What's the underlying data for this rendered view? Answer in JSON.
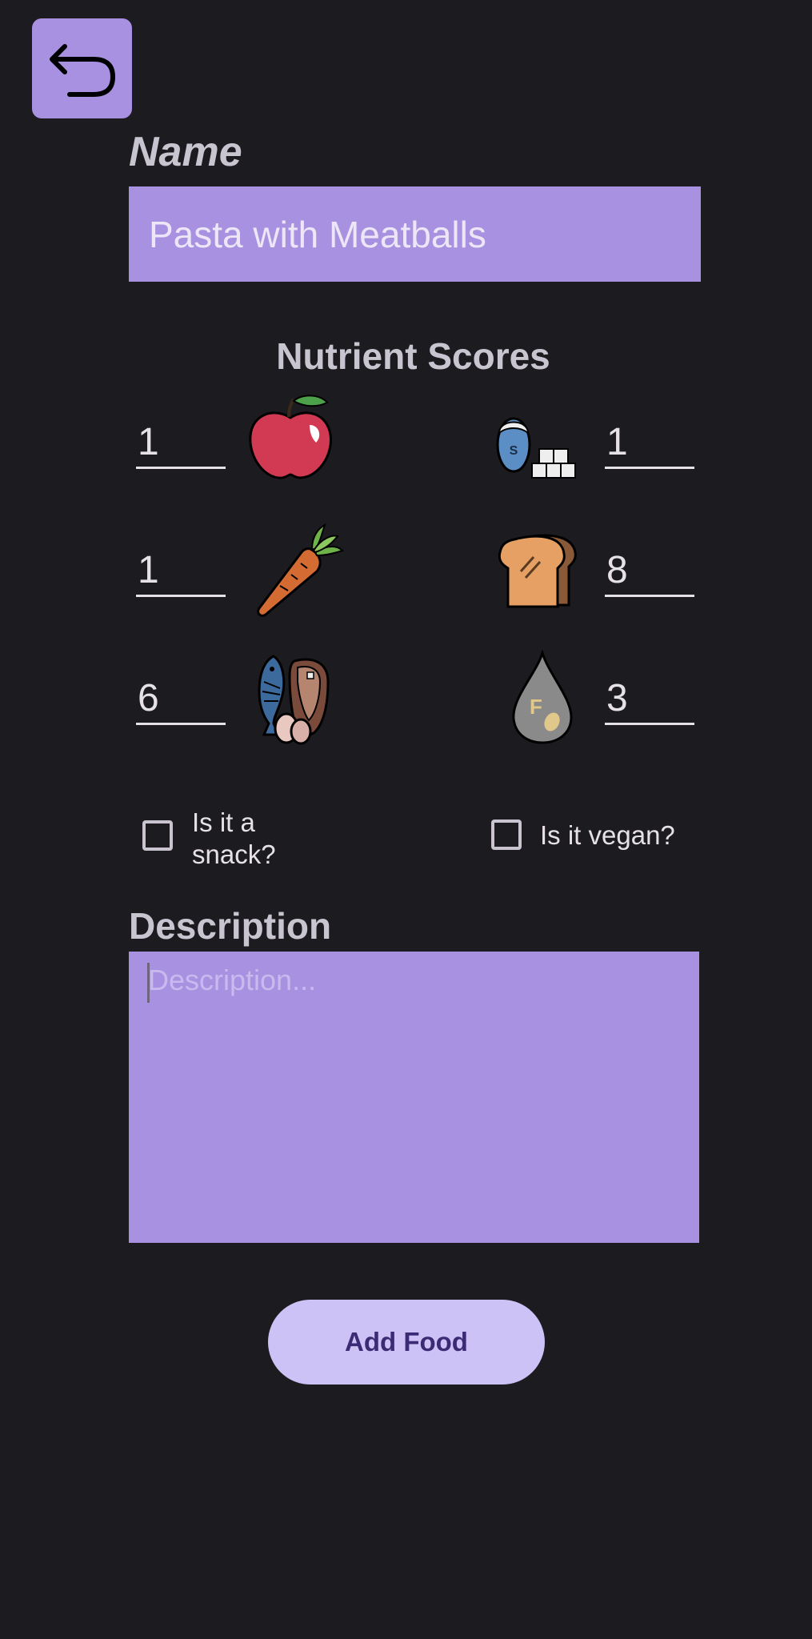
{
  "header": {
    "back_icon": "undo-arrow-icon"
  },
  "name": {
    "label": "Name",
    "value": "Pasta with Meatballs"
  },
  "nutrients": {
    "title": "Nutrient Scores",
    "items": [
      {
        "value": "1",
        "icon": "apple-icon"
      },
      {
        "value": "1",
        "icon": "salt-sugar-icon"
      },
      {
        "value": "1",
        "icon": "carrot-icon"
      },
      {
        "value": "8",
        "icon": "bread-icon"
      },
      {
        "value": "6",
        "icon": "protein-fish-meat-egg-icon"
      },
      {
        "value": "3",
        "icon": "fat-drop-icon"
      }
    ]
  },
  "options": {
    "snack_label": "Is it a snack?",
    "vegan_label": "Is it vegan?",
    "snack_checked": false,
    "vegan_checked": false
  },
  "description": {
    "label": "Description",
    "placeholder": "Description...",
    "value": ""
  },
  "actions": {
    "add_label": "Add Food"
  },
  "colors": {
    "background": "#1c1b1f",
    "field": "#a891e1",
    "button": "#ccc2f5"
  }
}
